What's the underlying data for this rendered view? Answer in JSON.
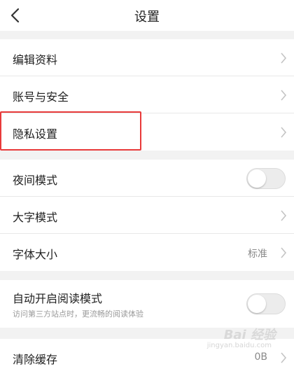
{
  "header": {
    "title": "设置"
  },
  "section1": [
    {
      "label": "编辑资料"
    },
    {
      "label": "账号与安全"
    },
    {
      "label": "隐私设置"
    }
  ],
  "section2": {
    "night_mode": {
      "label": "夜间模式",
      "enabled": false
    },
    "large_text": {
      "label": "大字模式"
    },
    "font_size": {
      "label": "字体大小",
      "value": "标准"
    }
  },
  "section3": {
    "auto_reader": {
      "label": "自动开启阅读模式",
      "subtitle": "访问第三方站点时，更流畅的阅读体验",
      "enabled": false
    }
  },
  "section4": {
    "clear_cache": {
      "label": "清除缓存",
      "value": "0B"
    }
  },
  "watermark": {
    "text": "Bai 经验",
    "sub": "jingyan.baidu.com"
  },
  "colors": {
    "highlight": "#e83a3a",
    "background": "#f2f2f2"
  }
}
